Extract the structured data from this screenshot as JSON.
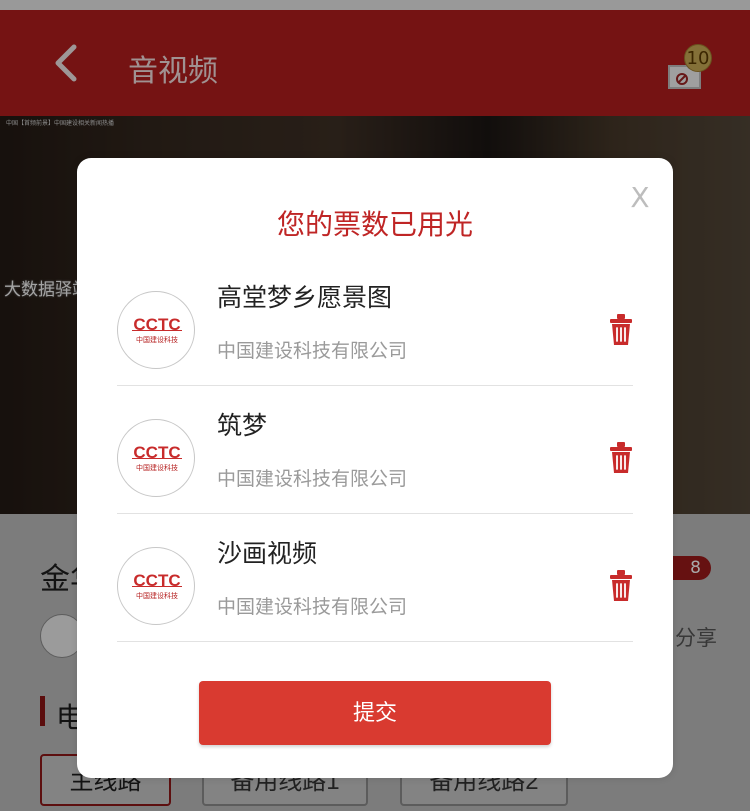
{
  "header": {
    "title": "音视频",
    "ticket_count": "10"
  },
  "video": {
    "caption": "中国【首频前景】中国建设相关新闻热播"
  },
  "background": {
    "page_title_partial": "金华",
    "badge_value": "8",
    "share_label": "分享",
    "section_label": "电",
    "routes": [
      "主线路",
      "备用线路1",
      "备用线路2"
    ]
  },
  "modal": {
    "close_label": "X",
    "title": "您的票数已用光",
    "items": [
      {
        "name": "高堂梦乡愿景图",
        "company": "中国建设科技有限公司",
        "logo_text": "CCTC",
        "logo_subtext": "中国建设科技"
      },
      {
        "name": "筑梦",
        "company": "中国建设科技有限公司",
        "logo_text": "CCTC",
        "logo_subtext": "中国建设科技"
      },
      {
        "name": "沙画视频",
        "company": "中国建设科技有限公司",
        "logo_text": "CCTC",
        "logo_subtext": "中国建设科技"
      }
    ],
    "submit_label": "提交"
  },
  "watermark": "大数据驿站",
  "colors": {
    "header": "#b21e1e",
    "accent": "#d93a30",
    "title": "#bf2525"
  }
}
